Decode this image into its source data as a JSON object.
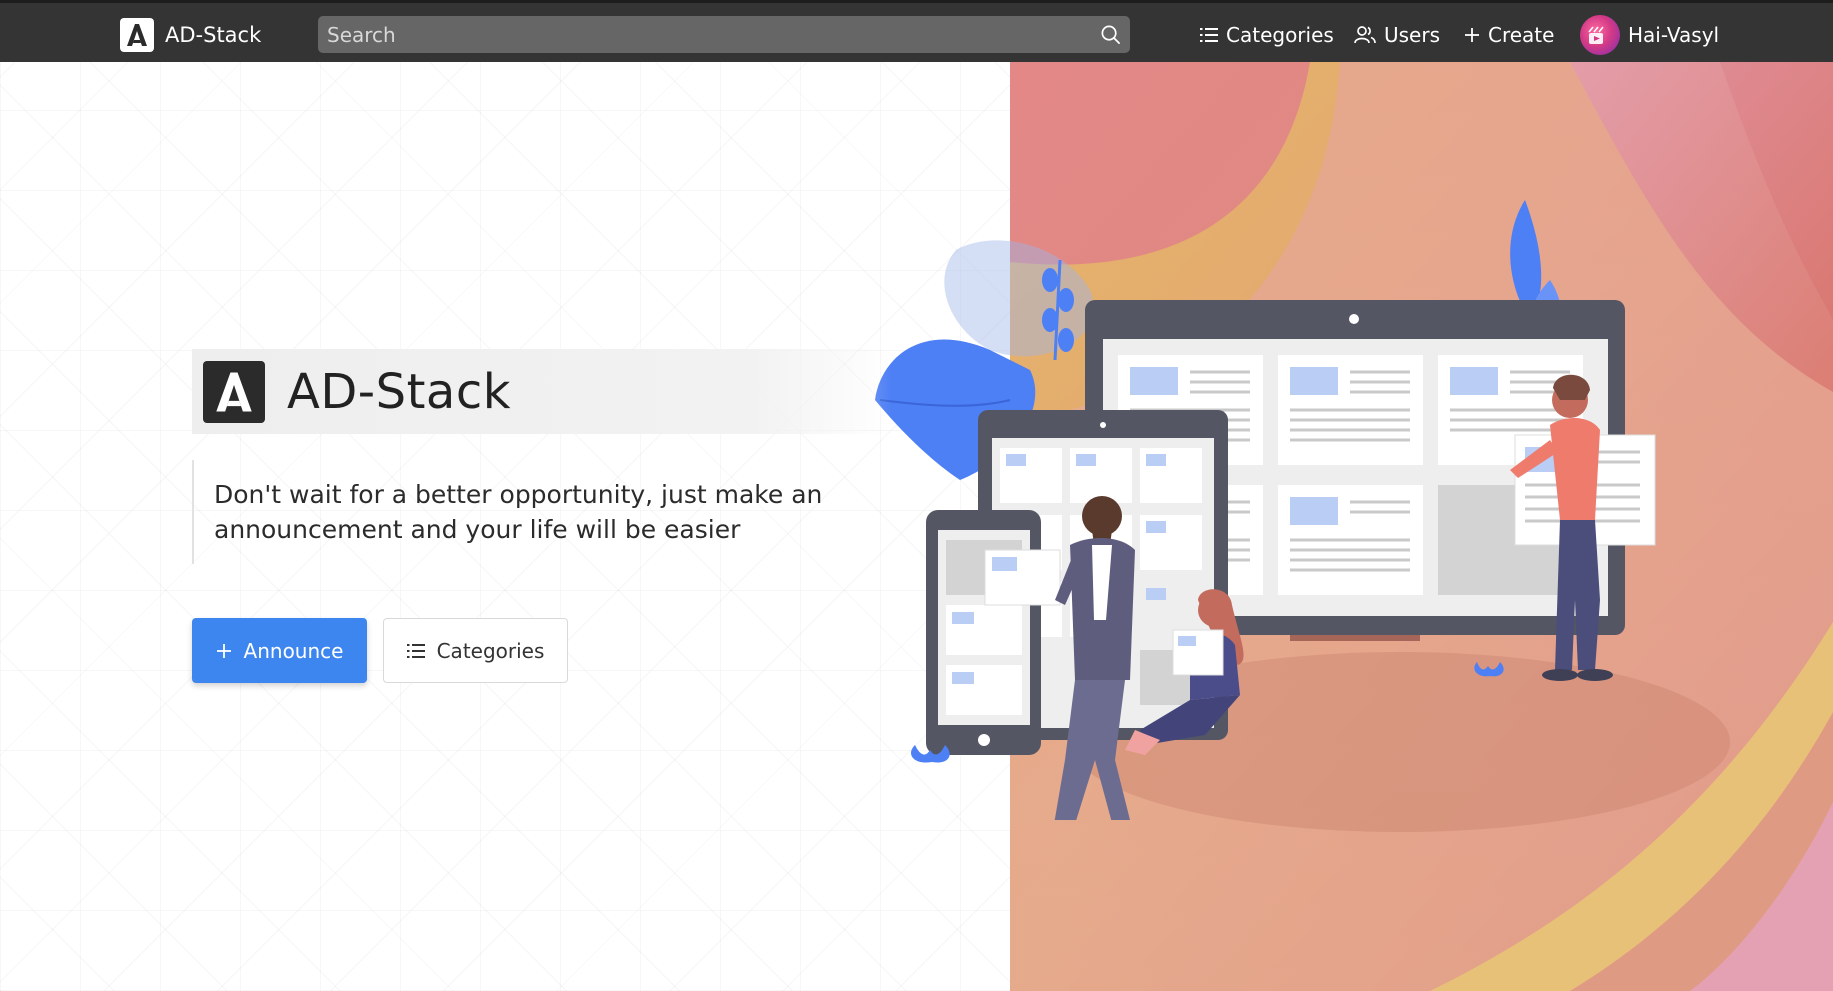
{
  "navbar": {
    "brand": "AD-Stack",
    "search_placeholder": "Search",
    "categories_label": "Categories",
    "users_label": "Users",
    "create_label": "Create",
    "username": "Hai-Vasyl"
  },
  "hero": {
    "title": "AD-Stack",
    "tagline": "Don't wait for a better opportunity, just make an announcement and your life will be easier",
    "announce_label": "Announce",
    "categories_label": "Categories"
  },
  "colors": {
    "navbar": "#343434",
    "accent": "#3d86f0",
    "illustration_blue": "#4d7ff5",
    "illustration_dark": "#545663"
  },
  "icons": [
    "a-logo-icon",
    "search-icon",
    "list-icon",
    "users-icon",
    "plus-icon",
    "avatar-icon"
  ]
}
